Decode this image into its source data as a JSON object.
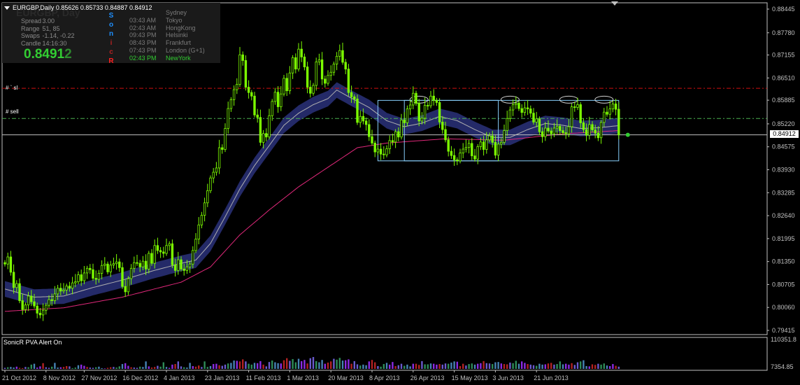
{
  "header": {
    "symbol_line": "EURGBP,Daily  0.85626 0.85733 0.84887 0.84912",
    "watermark": "EURGBP, Day"
  },
  "stats": [
    {
      "key": "Spread",
      "value": "3.00"
    },
    {
      "key": "Range",
      "value": "51, 85"
    },
    {
      "key": "Swaps",
      "value": "-1.14, -0.22"
    },
    {
      "key": "Candle",
      "value": "14:16:30"
    }
  ],
  "big_price": {
    "main": "0.8491",
    "tail": "2"
  },
  "sonic_letters": [
    {
      "ch": "S",
      "color": "#1e90ff"
    },
    {
      "ch": "o",
      "color": "#1e90ff"
    },
    {
      "ch": "n",
      "color": "#1e90ff"
    },
    {
      "ch": "i",
      "color": "#b22222"
    },
    {
      "ch": "c",
      "color": "#b22222"
    },
    {
      "ch": "R",
      "color": "#ff2020"
    }
  ],
  "sessions": [
    {
      "time": "",
      "city": "Sydney",
      "color": "#7a7a7a"
    },
    {
      "time": "03:43 AM",
      "city": "Tokyo",
      "color": "#7a7a7a"
    },
    {
      "time": "02:43 AM",
      "city": "HongKong",
      "color": "#7a7a7a"
    },
    {
      "time": "09:43 PM",
      "city": "Helsinki",
      "color": "#7a7a7a"
    },
    {
      "time": "08:43 PM",
      "city": "Frankfurt",
      "color": "#7a7a7a"
    },
    {
      "time": "07:43 PM",
      "city": "London  (G+1)",
      "color": "#7a7a7a"
    },
    {
      "time": "02:43 PM",
      "city": "NewYork",
      "color": "#32cd32"
    }
  ],
  "line_tags": {
    "sl": "#         `  sl",
    "sell": "#           sell"
  },
  "pva_label": "SonicR PVA   Alert On",
  "current_price": "0.84912",
  "price_axis": [
    "0.88445",
    "0.87780",
    "0.87155",
    "0.86510",
    "0.85885",
    "0.85220",
    "0.84575",
    "0.83930",
    "0.83285",
    "0.82640",
    "0.81995",
    "0.81350",
    "0.80705",
    "0.80060",
    "0.79415"
  ],
  "volume_axis": [
    "110351.8",
    "7354.85"
  ],
  "x_labels": [
    "21 Oct 2012",
    "8 Nov 2012",
    "27 Nov 2012",
    "16 Dec 2012",
    "4 Jan 2013",
    "23 Jan 2013",
    "11 Feb 2013",
    "1 Mar 2013",
    "20 Mar 2013",
    "8 Apr 2013",
    "26 Apr 2013",
    "15 May 2013",
    "3 Jun 2013",
    "21 Jun 2013"
  ],
  "colors": {
    "candle": "#7cfc00",
    "band": "#262c6e",
    "band_mid": "#b0b0b0",
    "ma_slow": "#e0287a",
    "sl_line": "#d01010",
    "sell_line": "#4caf50",
    "box": "#87cefa",
    "volume_palette": [
      "#6a5acd",
      "#4682b4",
      "#b22222",
      "#2e8b57",
      "#8a2be2"
    ]
  },
  "chart_data": {
    "type": "candlestick",
    "series": [
      {
        "name": "EURGBP,Daily",
        "values": [
          0.8128,
          0.8148,
          0.8105,
          0.8062,
          0.8073,
          0.8025,
          0.8,
          0.8013,
          0.8038,
          0.8022,
          0.801,
          0.799,
          0.7985,
          0.7998,
          0.8012,
          0.8028,
          0.8025,
          0.8044,
          0.806,
          0.8052,
          0.8055,
          0.8066,
          0.806,
          0.8075,
          0.8078,
          0.8098,
          0.8081,
          0.8103,
          0.8116,
          0.8112,
          0.8088,
          0.8085,
          0.8102,
          0.8124,
          0.8128,
          0.8106,
          0.8125,
          0.8129,
          0.8134,
          0.8118,
          0.8065,
          0.805,
          0.8087,
          0.8116,
          0.8132,
          0.813,
          0.812,
          0.8136,
          0.8114,
          0.8158,
          0.813,
          0.818,
          0.8166,
          0.8162,
          0.8158,
          0.818,
          0.8185,
          0.8126,
          0.811,
          0.814,
          0.8114,
          0.811,
          0.812,
          0.8128,
          0.8166,
          0.8198,
          0.8238,
          0.8265,
          0.83,
          0.8334,
          0.837,
          0.8386,
          0.8398,
          0.8455,
          0.845,
          0.8509,
          0.8565,
          0.859,
          0.8618,
          0.8633,
          0.8716,
          0.87,
          0.8625,
          0.861,
          0.86,
          0.8547,
          0.854,
          0.847,
          0.8495,
          0.8485,
          0.8545,
          0.8585,
          0.8611,
          0.857,
          0.8606,
          0.865,
          0.8615,
          0.8665,
          0.8708,
          0.8676,
          0.8732,
          0.871,
          0.8682,
          0.8625,
          0.8608,
          0.863,
          0.8696,
          0.8702,
          0.8648,
          0.8636,
          0.8658,
          0.8667,
          0.869,
          0.8712,
          0.8728,
          0.8695,
          0.8676,
          0.861,
          0.8598,
          0.8592,
          0.8526,
          0.8543,
          0.853,
          0.852,
          0.8486,
          0.8468,
          0.8443,
          0.8451,
          0.8437,
          0.8435,
          0.8452,
          0.8475,
          0.8471,
          0.85,
          0.8485,
          0.8533,
          0.8525,
          0.8564,
          0.8575,
          0.8608,
          0.858,
          0.853,
          0.8538,
          0.8574,
          0.8573,
          0.86,
          0.8588,
          0.8582,
          0.8527,
          0.8506,
          0.8477,
          0.8445,
          0.8433,
          0.8421,
          0.8418,
          0.844,
          0.8451,
          0.8456,
          0.8467,
          0.8432,
          0.8423,
          0.8458,
          0.8471,
          0.845,
          0.8477,
          0.8488,
          0.847,
          0.8434,
          0.8465,
          0.847,
          0.8503,
          0.8537,
          0.8561,
          0.8576,
          0.858,
          0.8565,
          0.8554,
          0.8567,
          0.8564,
          0.8552,
          0.8527,
          0.8536,
          0.85,
          0.8486,
          0.851,
          0.8502,
          0.8494,
          0.851,
          0.8515,
          0.8503,
          0.8497,
          0.8494,
          0.8514,
          0.857,
          0.8568,
          0.8576,
          0.8525,
          0.8506,
          0.849,
          0.852,
          0.8505,
          0.8496,
          0.8483,
          0.8526,
          0.8555,
          0.8549,
          0.8564,
          0.8578,
          0.8563,
          0.8491
        ]
      }
    ],
    "price_range": [
      0.79415,
      0.88445
    ],
    "sl_level": 0.8622,
    "sell_level": 0.8537,
    "current_level": 0.84912,
    "moving_average_band": [
      {
        "x": 0,
        "y": 0.8058
      },
      {
        "x": 10,
        "y": 0.8035
      },
      {
        "x": 20,
        "y": 0.8038
      },
      {
        "x": 30,
        "y": 0.8062
      },
      {
        "x": 40,
        "y": 0.8083
      },
      {
        "x": 50,
        "y": 0.8108
      },
      {
        "x": 60,
        "y": 0.813
      },
      {
        "x": 65,
        "y": 0.8139
      },
      {
        "x": 70,
        "y": 0.8186
      },
      {
        "x": 75,
        "y": 0.8261
      },
      {
        "x": 80,
        "y": 0.8339
      },
      {
        "x": 85,
        "y": 0.8405
      },
      {
        "x": 90,
        "y": 0.8461
      },
      {
        "x": 95,
        "y": 0.8518
      },
      {
        "x": 100,
        "y": 0.8552
      },
      {
        "x": 105,
        "y": 0.8576
      },
      {
        "x": 110,
        "y": 0.8593
      },
      {
        "x": 113,
        "y": 0.8617
      },
      {
        "x": 118,
        "y": 0.8594
      },
      {
        "x": 124,
        "y": 0.8568
      },
      {
        "x": 130,
        "y": 0.8531
      },
      {
        "x": 136,
        "y": 0.8514
      },
      {
        "x": 142,
        "y": 0.8524
      },
      {
        "x": 148,
        "y": 0.8543
      },
      {
        "x": 154,
        "y": 0.8531
      },
      {
        "x": 160,
        "y": 0.8506
      },
      {
        "x": 166,
        "y": 0.8484
      },
      {
        "x": 172,
        "y": 0.8484
      },
      {
        "x": 178,
        "y": 0.8506
      },
      {
        "x": 184,
        "y": 0.8523
      },
      {
        "x": 190,
        "y": 0.8518
      },
      {
        "x": 196,
        "y": 0.8509
      },
      {
        "x": 202,
        "y": 0.8511
      },
      {
        "x": 209,
        "y": 0.8517
      }
    ],
    "moving_average_slow": [
      {
        "x": 0,
        "y": 0.7995
      },
      {
        "x": 20,
        "y": 0.8005
      },
      {
        "x": 40,
        "y": 0.8035
      },
      {
        "x": 60,
        "y": 0.8077
      },
      {
        "x": 70,
        "y": 0.812
      },
      {
        "x": 80,
        "y": 0.821
      },
      {
        "x": 90,
        "y": 0.828
      },
      {
        "x": 100,
        "y": 0.8345
      },
      {
        "x": 110,
        "y": 0.84
      },
      {
        "x": 120,
        "y": 0.8455
      },
      {
        "x": 130,
        "y": 0.8468
      },
      {
        "x": 150,
        "y": 0.848
      },
      {
        "x": 170,
        "y": 0.8476
      },
      {
        "x": 190,
        "y": 0.8494
      },
      {
        "x": 209,
        "y": 0.8503
      }
    ],
    "range_boxes": [
      {
        "x_from": 127,
        "x_to": 168,
        "y_from": 0.8418,
        "y_to": 0.8588
      },
      {
        "x_from": 136,
        "x_to": 209,
        "y_from": 0.8418,
        "y_to": 0.8588
      }
    ],
    "top_markers": [
      141,
      172,
      192,
      204
    ],
    "volume": [
      11000,
      13000,
      14000,
      12000,
      15000,
      11000,
      10000,
      14000,
      13000,
      22000,
      25000,
      12000,
      16000,
      27000,
      13000,
      11000,
      15000,
      28000,
      12000,
      13000,
      14000,
      17000,
      16000,
      10000,
      12000,
      20000,
      22000,
      18000,
      14000,
      12000,
      11000,
      13000,
      15000,
      10000,
      9000,
      11000,
      13000,
      14000,
      12000,
      16000,
      24000,
      27000,
      18000,
      13000,
      12000,
      11000,
      15000,
      14000,
      33000,
      16000,
      12000,
      14000,
      18000,
      15000,
      30000,
      14000,
      11000,
      22000,
      24000,
      33000,
      16000,
      13000,
      12000,
      28000,
      17000,
      15000,
      19000,
      14000,
      33000,
      14000,
      17000,
      24000,
      25000,
      20000,
      18000,
      22000,
      26000,
      28000,
      36000,
      35000,
      33000,
      40000,
      33000,
      25000,
      22000,
      28000,
      27000,
      34000,
      22000,
      16000,
      31000,
      36000,
      30000,
      27000,
      26000,
      37000,
      44000,
      35000,
      41000,
      30000,
      42000,
      34000,
      38000,
      26000,
      44000,
      48000,
      34000,
      30000,
      38000,
      25000,
      29000,
      33000,
      42000,
      39000,
      45000,
      36000,
      37000,
      40000,
      25000,
      34000,
      23000,
      19000,
      22000,
      20000,
      33000,
      38000,
      30000,
      17000,
      15000,
      24000,
      28000,
      22000,
      31000,
      17000,
      20000,
      25000,
      18000,
      22000,
      16000,
      25000,
      25000,
      21000,
      34000,
      23000,
      23000,
      26000,
      25000,
      22000,
      24000,
      22000,
      26000,
      25000,
      29000,
      33000,
      32000,
      17000,
      25000,
      19000,
      24000,
      26000,
      22000,
      25000,
      27000,
      34000,
      27000,
      26000,
      24000,
      30000,
      31000,
      26000,
      24000,
      23000,
      29000,
      27000,
      35000,
      25000,
      33000,
      28000,
      24000,
      22000,
      20000,
      18000,
      25000,
      22000,
      23000,
      26000,
      28000,
      22000,
      24000,
      33000,
      23000,
      25000,
      22000,
      27000,
      21000,
      30000,
      33000,
      37000,
      17000,
      16000,
      23000,
      21000,
      25000,
      22000,
      26000,
      19000,
      17000,
      24000,
      18000,
      15000
    ],
    "volume_range": [
      7354.85,
      110351.8
    ],
    "x_tick_index": [
      0,
      14,
      27,
      41,
      55,
      69,
      83,
      97,
      111,
      125,
      139,
      153,
      167,
      181
    ]
  }
}
